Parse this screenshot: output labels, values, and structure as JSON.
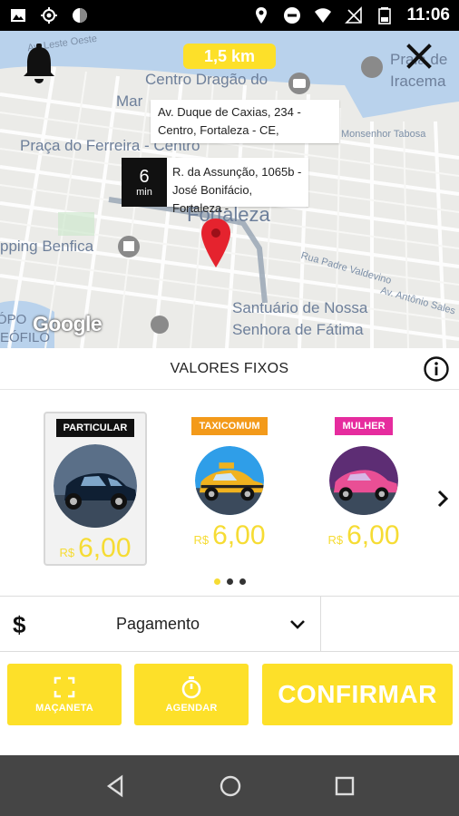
{
  "status_bar": {
    "time": "11:06",
    "left_icons": [
      "image-icon",
      "crosshair-icon",
      "circle-icon"
    ],
    "right_icons": [
      "location-pin-icon",
      "do-not-disturb-icon",
      "wifi-icon",
      "signal-off-icon",
      "battery-icon"
    ]
  },
  "map": {
    "distance": "1,5 km",
    "streets": {
      "leste_oeste": "Av. Leste Oeste",
      "mons_tabosa": "Monsenhor Tabosa",
      "padre_valdevino": "Rua Padre Valdevino",
      "antonio_sales": "Av. Antônio Sales"
    },
    "places": {
      "dragao": "Centro Dragão do",
      "mar": "Mar",
      "praia": "Praia de",
      "iracema": "Iracema",
      "praca": "Praça do Ferreira - Centro",
      "fortaleza": "Fortaleza",
      "shopping": "pping Benfica",
      "santuario_1": "Santuário de Nossa",
      "santuario_2": "Senhora de Fátima",
      "bairro_1": "ÓPO",
      "bairro_2": "EÓFILO"
    },
    "origin_line1": "Av. Duque de Caxias, 234 -",
    "origin_line2": "Centro, Fortaleza - CE,",
    "destination_line1": "R. da Assunção, 1065b -",
    "destination_line2": "José Bonifácio, Fortaleza -",
    "eta_value": "6",
    "eta_unit": "min",
    "google": "Google"
  },
  "section": {
    "title": "VALORES FIXOS"
  },
  "categories": [
    {
      "label": "PARTICULAR",
      "currency": "R$",
      "price": "6,00",
      "selected": true
    },
    {
      "label": "TAXICOMUM",
      "currency": "R$",
      "price": "6,00",
      "selected": false
    },
    {
      "label": "MULHER",
      "currency": "R$",
      "price": "6,00",
      "selected": false
    }
  ],
  "pagination": {
    "pages": 3,
    "active": 0
  },
  "payment": {
    "icon": "$",
    "label": "Pagamento"
  },
  "actions": {
    "macaneta": "MAÇANETA",
    "agendar": "AGENDAR",
    "confirmar": "CONFIRMAR"
  },
  "colors": {
    "accent_yellow": "#fde029",
    "price_yellow": "#f6dc34",
    "badge_taxi": "#f39a1a",
    "badge_mulher": "#e62c9e",
    "pin_red": "#e5232e"
  }
}
